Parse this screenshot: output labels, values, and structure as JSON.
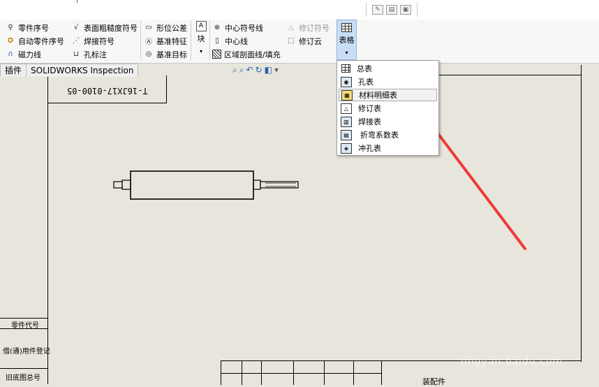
{
  "ribbon": {
    "col1": [
      {
        "icon": "pin-icon",
        "label": "零件序号"
      },
      {
        "icon": "auto-balloon-icon",
        "label": "自动零件序号"
      },
      {
        "icon": "magnet-icon",
        "label": "磁力线"
      }
    ],
    "col2": [
      {
        "icon": "surface-finish-icon",
        "label": "表面粗糙度符号"
      },
      {
        "icon": "weld-icon",
        "label": "焊接符号"
      },
      {
        "icon": "hole-callout-icon",
        "label": "孔标注"
      }
    ],
    "col3": [
      {
        "icon": "geometric-tolerance-icon",
        "label": "形位公差"
      },
      {
        "icon": "datum-feature-icon",
        "label": "基准特征"
      },
      {
        "icon": "datum-target-icon",
        "label": "基准目标"
      }
    ],
    "block": {
      "label": "块",
      "icon": "block-icon"
    },
    "col4": [
      {
        "icon": "center-mark-icon",
        "label": "中心符号线"
      },
      {
        "icon": "centerline-icon",
        "label": "中心线"
      },
      {
        "icon": "hatch-icon",
        "label": "区域剖面线/填充"
      }
    ],
    "col5": [
      {
        "icon": "revision-symbol-icon",
        "label": "修订符号",
        "disabled": true
      },
      {
        "icon": "revision-cloud-icon",
        "label": "修订云",
        "disabled": false
      }
    ],
    "table_button": {
      "label": "表格",
      "icon": "table-icon"
    }
  },
  "tabs": [
    "插件",
    "SOLIDWORKS Inspection"
  ],
  "dropdown": {
    "items": [
      {
        "icon": "general-table-icon",
        "label": "总表"
      },
      {
        "icon": "hole-table-icon",
        "label": "孔表"
      },
      {
        "icon": "bom-icon",
        "label": "材料明细表",
        "selected": true
      },
      {
        "icon": "revision-table-icon",
        "label": "修订表"
      },
      {
        "icon": "weldment-table-icon",
        "label": "焊接表"
      },
      {
        "icon": "bend-table-icon",
        "label": "折弯系数表"
      },
      {
        "icon": "punch-table-icon",
        "label": "冲孔表"
      }
    ]
  },
  "drawing": {
    "title_number": "T-16JX17-0100-05",
    "side_labels": [
      "零件代号",
      "借(通)用件登记",
      "旧底图总号"
    ],
    "bottom_label": "装配件"
  },
  "watermark": "jingyan.baidu.com",
  "colors": {
    "accent": "#c9def5",
    "arrow": "#ee3a3a",
    "paper": "#e8e6dc"
  }
}
